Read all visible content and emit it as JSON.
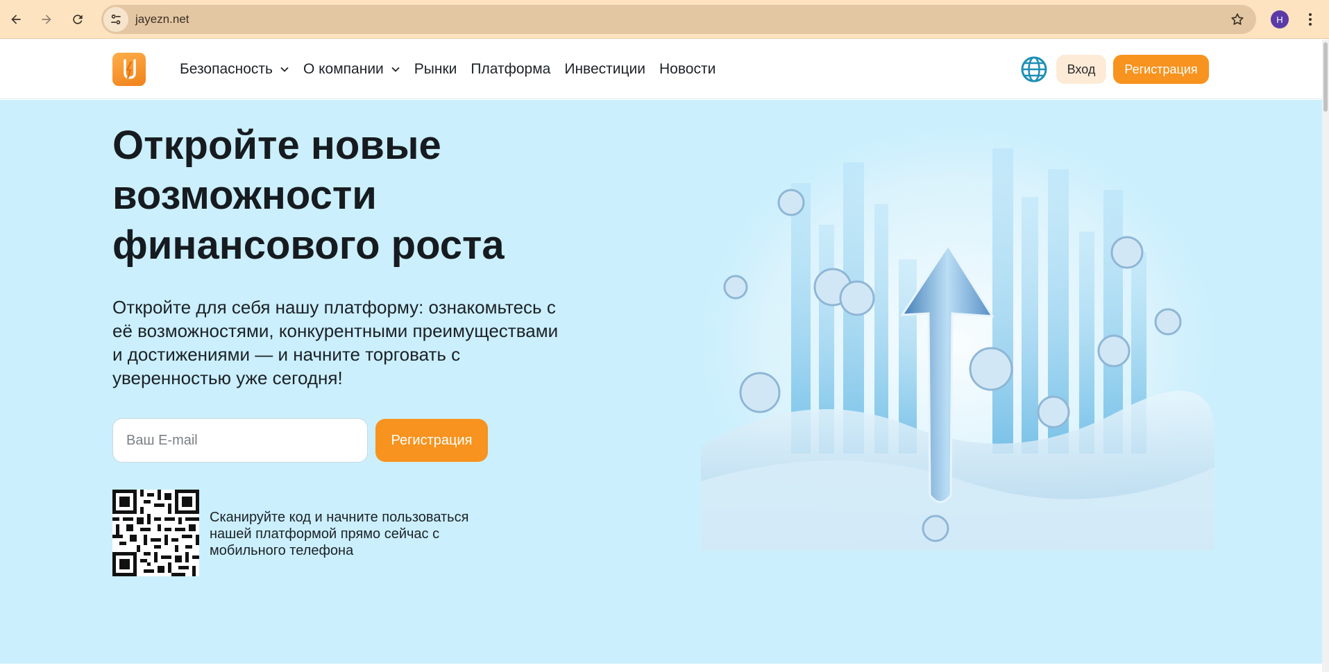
{
  "browser": {
    "url": "jayezn.net",
    "profile_initial": "H"
  },
  "header": {
    "menu": [
      {
        "label": "Безопасность",
        "has_dropdown": true
      },
      {
        "label": "О компании",
        "has_dropdown": true
      },
      {
        "label": "Рынки",
        "has_dropdown": false
      },
      {
        "label": "Платформа",
        "has_dropdown": false
      },
      {
        "label": "Инвестиции",
        "has_dropdown": false
      },
      {
        "label": "Новости",
        "has_dropdown": false
      }
    ],
    "login_label": "Вход",
    "register_label": "Регистрация"
  },
  "hero": {
    "title_lines": [
      "Откройте новые",
      "возможности",
      "финансового роста"
    ],
    "subtitle_lines": [
      "Откройте для себя нашу платформу: ознакомьтесь с",
      "её возможностями, конкурентными преимуществами",
      "и достижениями — и начните торговать с",
      "уверенностью уже сегодня!"
    ],
    "email_placeholder": "Ваш E-mail",
    "register_label": "Регистрация",
    "qr_text_lines": [
      "Сканируйте код и начните пользоваться",
      "нашей платформой прямо сейчас с",
      "мобильного телефона"
    ]
  },
  "colors": {
    "accent": "#f7931e",
    "hero_bg": "#cbeffd",
    "chrome_bg": "#fde3c0",
    "globe": "#1e8fb5"
  },
  "icons": [
    "back-icon",
    "forward-icon",
    "reload-icon",
    "tune-icon",
    "star-icon",
    "kebab-icon",
    "logo-icon",
    "chevron-down-icon",
    "globe-icon",
    "qr-code-icon"
  ]
}
